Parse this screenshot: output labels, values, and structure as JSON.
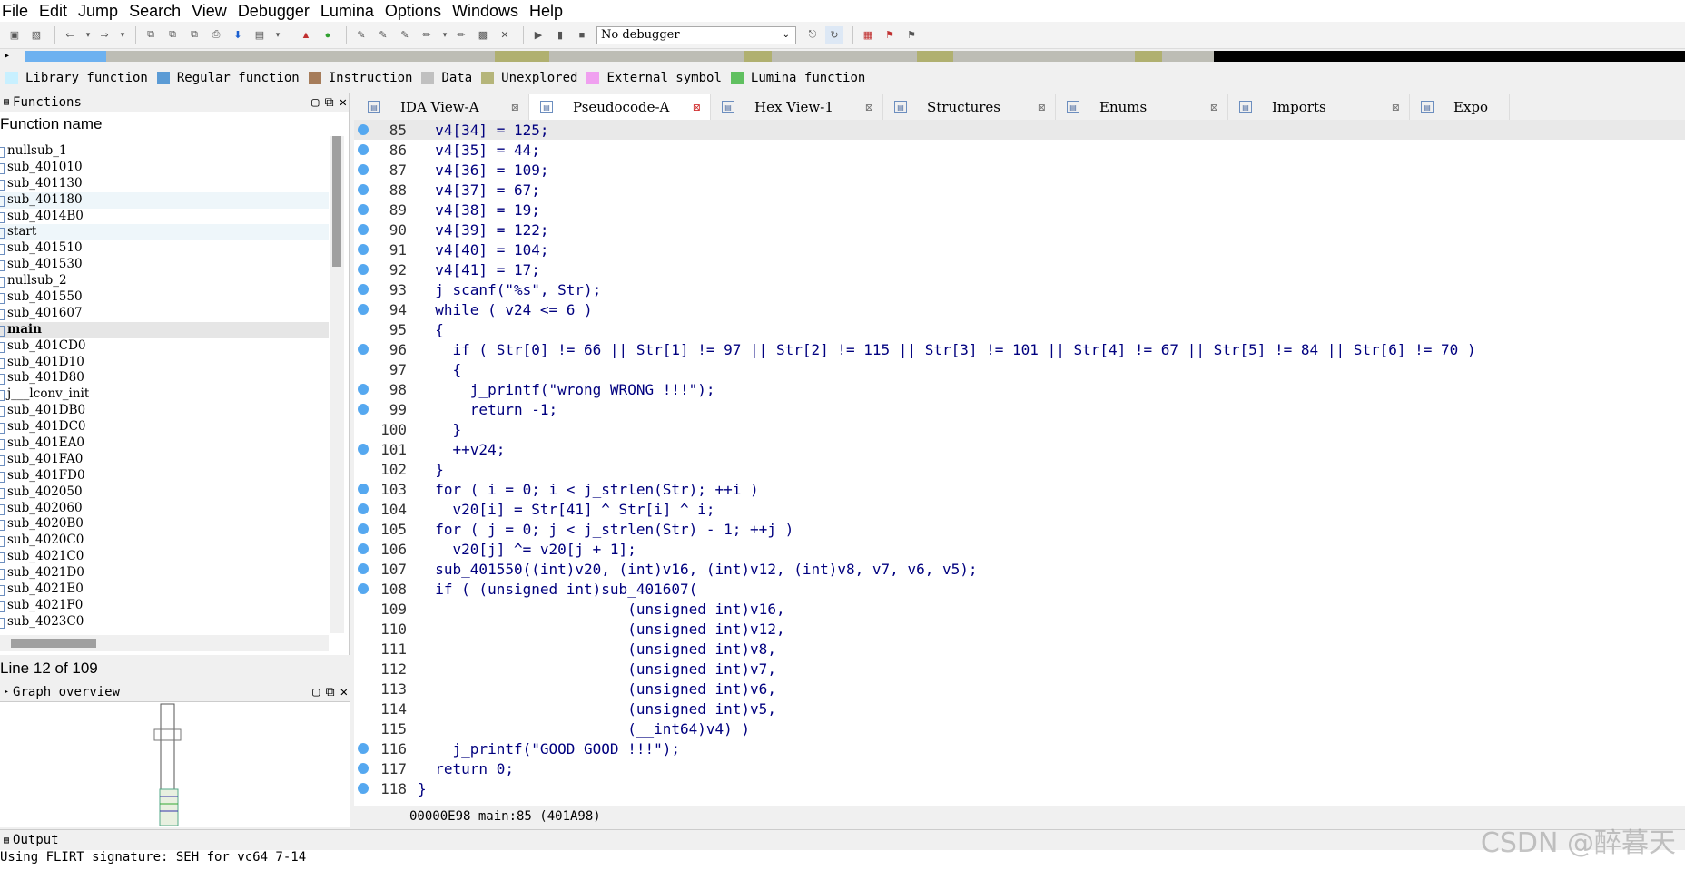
{
  "menu": [
    "File",
    "Edit",
    "Jump",
    "Search",
    "View",
    "Debugger",
    "Lumina",
    "Options",
    "Windows",
    "Help"
  ],
  "toolbar": {
    "debugger_value": "No debugger"
  },
  "legend": [
    {
      "label": "Library function",
      "color": "#c8f0ff"
    },
    {
      "label": "Regular function",
      "color": "#5b9bd5"
    },
    {
      "label": "Instruction",
      "color": "#a67c5a"
    },
    {
      "label": "Data",
      "color": "#c0c0c0"
    },
    {
      "label": "Unexplored",
      "color": "#b5b57a"
    },
    {
      "label": "External symbol",
      "color": "#f0a0f0"
    },
    {
      "label": "Lumina function",
      "color": "#60c060"
    }
  ],
  "functions": {
    "title": "Functions",
    "column_header": "Function name",
    "items": [
      "nullsub_1",
      "sub_401010",
      "sub_401130",
      "sub_401180",
      "sub_4014B0",
      "start",
      "sub_401510",
      "sub_401530",
      "nullsub_2",
      "sub_401550",
      "sub_401607",
      "main",
      "sub_401CD0",
      "sub_401D10",
      "sub_401D80",
      "j___lconv_init",
      "sub_401DB0",
      "sub_401DC0",
      "sub_401EA0",
      "sub_401FA0",
      "sub_401FD0",
      "sub_402050",
      "sub_402060",
      "sub_4020B0",
      "sub_4020C0",
      "sub_4021C0",
      "sub_4021D0",
      "sub_4021E0",
      "sub_4021F0",
      "sub_4023C0"
    ],
    "line_status": "Line 12 of 109"
  },
  "graph": {
    "title": "Graph overview"
  },
  "tabs": [
    {
      "label": "IDA View-A"
    },
    {
      "label": "Pseudocode-A"
    },
    {
      "label": "Hex View-1"
    },
    {
      "label": "Structures"
    },
    {
      "label": "Enums"
    },
    {
      "label": "Imports"
    },
    {
      "label": "Expo"
    }
  ],
  "code": [
    {
      "n": "85",
      "bp": true,
      "t": "  v4[34] = 125;"
    },
    {
      "n": "86",
      "bp": true,
      "t": "  v4[35] = 44;"
    },
    {
      "n": "87",
      "bp": true,
      "t": "  v4[36] = 109;"
    },
    {
      "n": "88",
      "bp": true,
      "t": "  v4[37] = 67;"
    },
    {
      "n": "89",
      "bp": true,
      "t": "  v4[38] = 19;"
    },
    {
      "n": "90",
      "bp": true,
      "t": "  v4[39] = 122;"
    },
    {
      "n": "91",
      "bp": true,
      "t": "  v4[40] = 104;"
    },
    {
      "n": "92",
      "bp": true,
      "t": "  v4[41] = 17;"
    },
    {
      "n": "93",
      "bp": true,
      "t": "  j_scanf(\"%s\", Str);"
    },
    {
      "n": "94",
      "bp": true,
      "t": "  while ( v24 <= 6 )"
    },
    {
      "n": "95",
      "bp": false,
      "t": "  {"
    },
    {
      "n": "96",
      "bp": true,
      "t": "    if ( Str[0] != 66 || Str[1] != 97 || Str[2] != 115 || Str[3] != 101 || Str[4] != 67 || Str[5] != 84 || Str[6] != 70 )"
    },
    {
      "n": "97",
      "bp": false,
      "t": "    {"
    },
    {
      "n": "98",
      "bp": true,
      "t": "      j_printf(\"wrong WRONG !!!\");"
    },
    {
      "n": "99",
      "bp": true,
      "t": "      return -1;"
    },
    {
      "n": "100",
      "bp": false,
      "t": "    }"
    },
    {
      "n": "101",
      "bp": true,
      "t": "    ++v24;"
    },
    {
      "n": "102",
      "bp": false,
      "t": "  }"
    },
    {
      "n": "103",
      "bp": true,
      "t": "  for ( i = 0; i < j_strlen(Str); ++i )"
    },
    {
      "n": "104",
      "bp": true,
      "t": "    v20[i] = Str[41] ^ Str[i] ^ i;"
    },
    {
      "n": "105",
      "bp": true,
      "t": "  for ( j = 0; j < j_strlen(Str) - 1; ++j )"
    },
    {
      "n": "106",
      "bp": true,
      "t": "    v20[j] ^= v20[j + 1];"
    },
    {
      "n": "107",
      "bp": true,
      "t": "  sub_401550((int)v20, (int)v16, (int)v12, (int)v8, v7, v6, v5);"
    },
    {
      "n": "108",
      "bp": true,
      "t": "  if ( (unsigned int)sub_401607("
    },
    {
      "n": "109",
      "bp": false,
      "t": "                        (unsigned int)v16,"
    },
    {
      "n": "110",
      "bp": false,
      "t": "                        (unsigned int)v12,"
    },
    {
      "n": "111",
      "bp": false,
      "t": "                        (unsigned int)v8,"
    },
    {
      "n": "112",
      "bp": false,
      "t": "                        (unsigned int)v7,"
    },
    {
      "n": "113",
      "bp": false,
      "t": "                        (unsigned int)v6,"
    },
    {
      "n": "114",
      "bp": false,
      "t": "                        (unsigned int)v5,"
    },
    {
      "n": "115",
      "bp": false,
      "t": "                        (__int64)v4) )"
    },
    {
      "n": "116",
      "bp": true,
      "t": "    j_printf(\"GOOD GOOD !!!\");"
    },
    {
      "n": "117",
      "bp": true,
      "t": "  return 0;"
    },
    {
      "n": "118",
      "bp": true,
      "t": "}"
    }
  ],
  "code_status": "00000E98 main:85 (401A98)",
  "output": {
    "title": "Output",
    "line": "Using FLIRT signature: SEH for vc64 7-14"
  },
  "watermark": "CSDN @醉暮天"
}
